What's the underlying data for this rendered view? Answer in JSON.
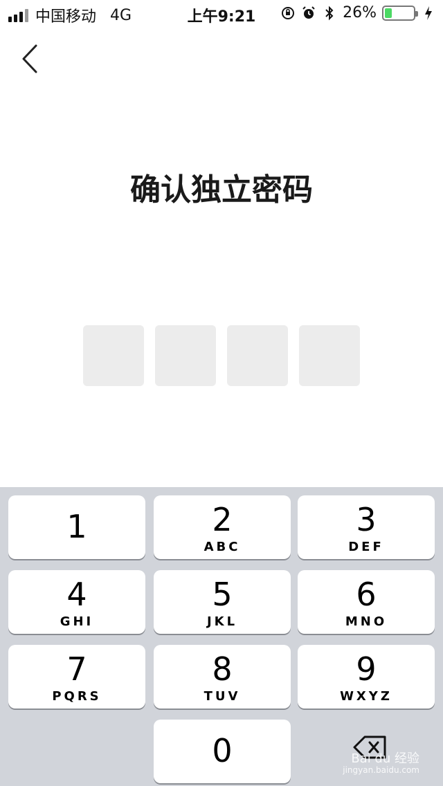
{
  "status_bar": {
    "carrier": "中国移动",
    "network": "4G",
    "time": "上午9:21",
    "battery_percent": "26%",
    "battery_level": 0.26,
    "icons": [
      "signal-icon",
      "orientation-lock-icon",
      "alarm-icon",
      "bluetooth-icon",
      "battery-icon",
      "charging-icon"
    ]
  },
  "nav": {
    "back_icon": "chevron-left-icon"
  },
  "title": "确认独立密码",
  "pin": {
    "length": 4,
    "filled": 0
  },
  "keypad": {
    "keys": [
      {
        "digit": "1",
        "letters": ""
      },
      {
        "digit": "2",
        "letters": "ABC"
      },
      {
        "digit": "3",
        "letters": "DEF"
      },
      {
        "digit": "4",
        "letters": "GHI"
      },
      {
        "digit": "5",
        "letters": "JKL"
      },
      {
        "digit": "6",
        "letters": "MNO"
      },
      {
        "digit": "7",
        "letters": "PQRS"
      },
      {
        "digit": "8",
        "letters": "TUV"
      },
      {
        "digit": "9",
        "letters": "WXYZ"
      },
      {
        "digit": "0",
        "letters": ""
      }
    ],
    "delete_icon": "backspace-icon"
  },
  "watermark": {
    "brand": "Bai du 经验",
    "url": "jingyan.baidu.com"
  },
  "colors": {
    "keyboard_bg": "#d1d4da",
    "pin_box": "#ececec",
    "battery": "#4cd964"
  }
}
